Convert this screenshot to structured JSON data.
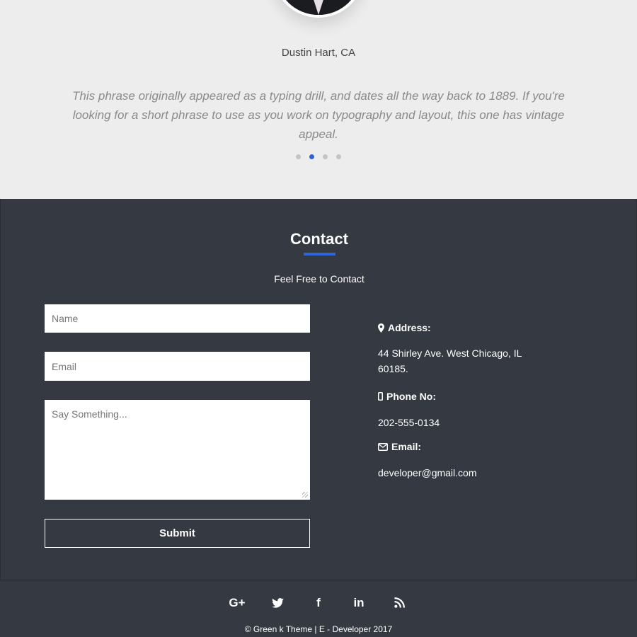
{
  "testimonial": {
    "name": "Dustin Hart, CA",
    "quote": "This phrase originally appeared as a typing drill, and dates all the way back to 1889. If you're looking for a short phrase to use as you work on typography and layout, this one has vintage appeal.",
    "dots_count": 4,
    "active_dot": 2
  },
  "contact": {
    "title": "Contact",
    "subtitle": "Feel Free to Contact",
    "form": {
      "name_placeholder": "Name",
      "email_placeholder": "Email",
      "message_placeholder": "Say Something...",
      "submit_label": "Submit"
    },
    "info": {
      "address_label": "Address:",
      "address_value": "44 Shirley Ave. West Chicago, IL 60185.",
      "phone_label": "Phone No:",
      "phone_value": "202-555-0134",
      "email_label": "Email:",
      "email_value": "developer@gmail.com"
    }
  },
  "footer": {
    "social_icons": [
      "google-plus-icon",
      "twitter-icon",
      "facebook-icon",
      "linkedin-icon",
      "rss-icon"
    ],
    "google_plus_glyph": "G+",
    "facebook_glyph": "f",
    "linkedin_glyph": "in",
    "copyright": "© Green k Theme | E - Developer 2017"
  },
  "colors": {
    "accent": "#2d64d8",
    "dark_bg": "#353a42",
    "light_bg": "#ededed"
  }
}
